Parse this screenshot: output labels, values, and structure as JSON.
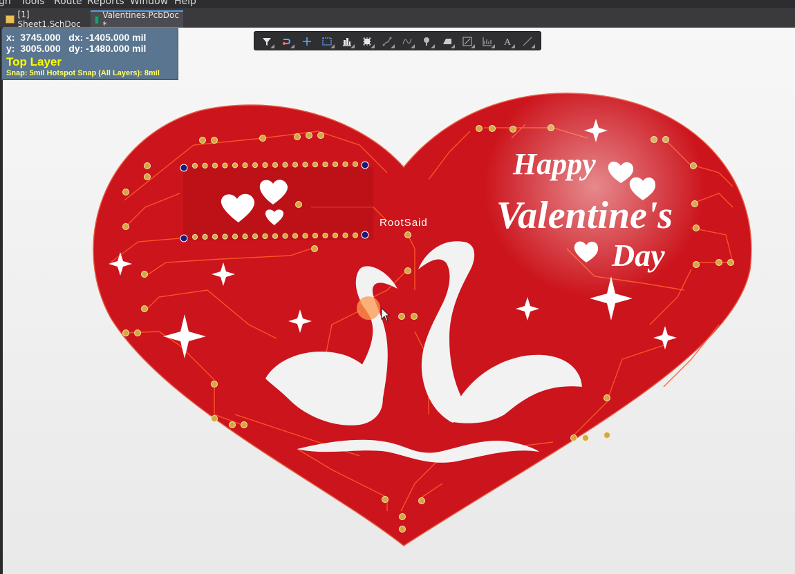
{
  "menu": {
    "items": [
      "gn",
      "Tools",
      "Route",
      "Reports",
      "Window",
      "Help"
    ]
  },
  "tabs": [
    {
      "label": "[1] Sheet1.SchDoc",
      "active": false
    },
    {
      "label": "Valentines.PcbDoc *",
      "active": true
    }
  ],
  "hud": {
    "line1": "x:  3745.000   dx: -1405.000 mil",
    "line2": "y:  3005.000   dy: -1480.000 mil",
    "layer": "Top Layer",
    "snap": "Snap: 5mil Hotspot Snap (All Layers): 8mil"
  },
  "toolbar": {
    "tools": [
      "filter-icon",
      "interactive-route-icon",
      "place-cross-icon",
      "select-rectangle-icon",
      "align-icon",
      "component-icon",
      "route-net-icon",
      "differential-pair-icon",
      "place-via-icon",
      "place-fill-icon",
      "region-icon",
      "graph-icon",
      "string-icon",
      "line-icon"
    ]
  },
  "board": {
    "label_rootsaid": "RootSaid",
    "text_happy": "Happy",
    "text_valentines": "Valentine's",
    "text_day": "Day",
    "board_color": "#cc141c",
    "trace_color": "#ff5a2a",
    "pad_color": "#d4a83c"
  }
}
